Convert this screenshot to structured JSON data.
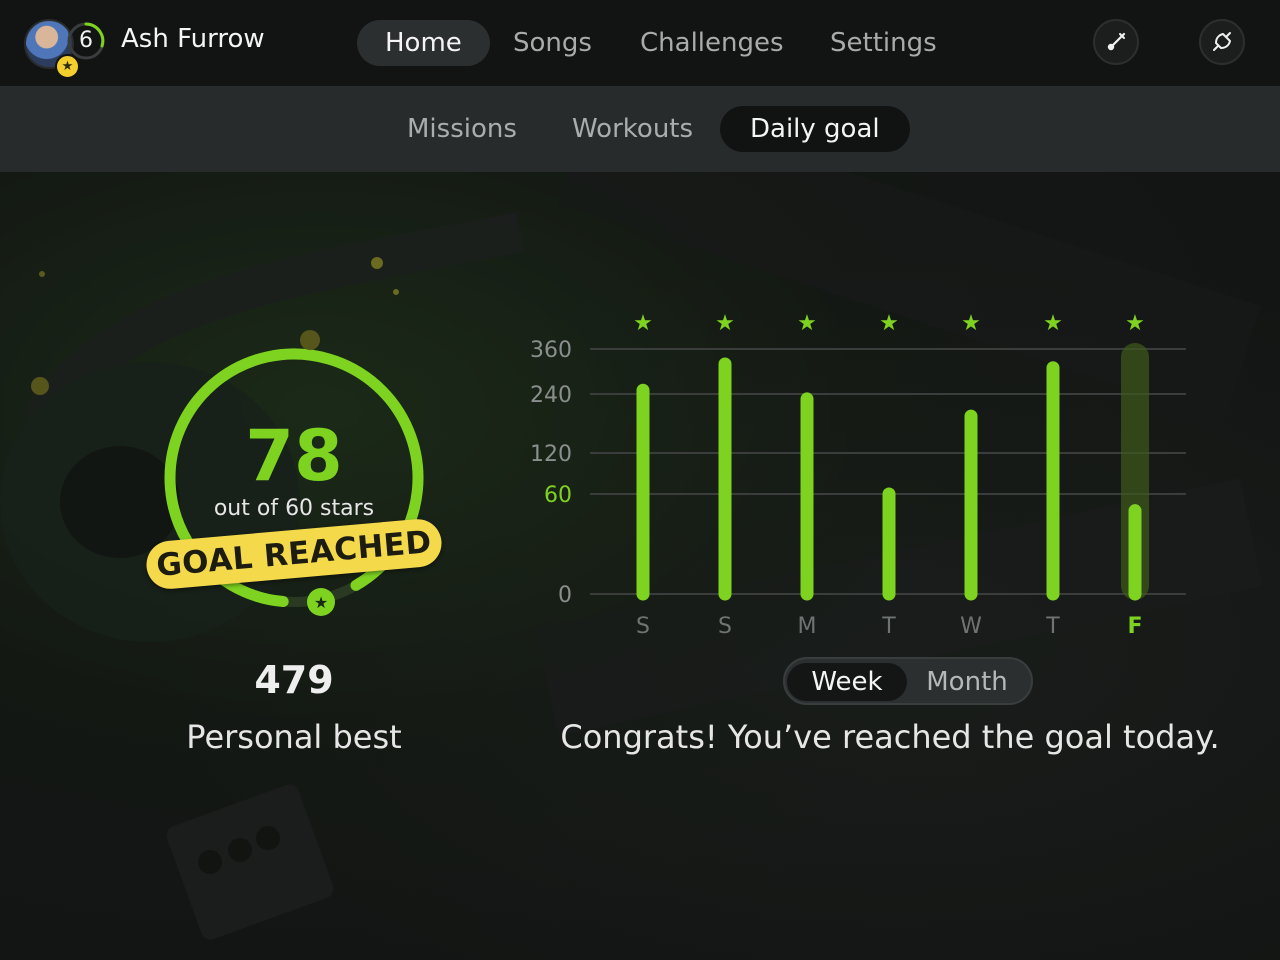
{
  "header": {
    "username": "Ash Furrow",
    "level": "6",
    "avatar_icon": "user-avatar",
    "badge_icon": "star-icon",
    "tabs": [
      {
        "label": "Home",
        "active": true
      },
      {
        "label": "Songs",
        "active": false
      },
      {
        "label": "Challenges",
        "active": false
      },
      {
        "label": "Settings",
        "active": false
      }
    ],
    "actions": [
      {
        "icon": "tuner-icon"
      },
      {
        "icon": "notifications-icon"
      }
    ]
  },
  "subnav": {
    "tabs": [
      {
        "label": "Missions",
        "active": false
      },
      {
        "label": "Workouts",
        "active": false
      },
      {
        "label": "Daily goal",
        "active": true
      }
    ]
  },
  "goal": {
    "stars": "78",
    "out_of": "out of 60 stars",
    "banner": "GOAL REACHED",
    "progress_fraction": 1.0,
    "personal_best_value": "479",
    "personal_best_label": "Personal best"
  },
  "chart_data": {
    "type": "bar",
    "categories": [
      "S",
      "S",
      "M",
      "T",
      "W",
      "T",
      "F"
    ],
    "values": [
      250,
      320,
      230,
      60,
      195,
      310,
      50
    ],
    "goal_reached": [
      true,
      true,
      true,
      true,
      true,
      true,
      true
    ],
    "highlight_index": 6,
    "yticks": [
      "360",
      "240",
      "120",
      "60",
      "0"
    ],
    "goal_tick": "60",
    "colors": {
      "bar": "#7ed321",
      "goal_tick": "#7ed321",
      "axis_text": "#8a8e8c",
      "grid": "#3a3d3c"
    }
  },
  "range_toggle": {
    "options": [
      {
        "label": "Week",
        "active": true
      },
      {
        "label": "Month",
        "active": false
      }
    ]
  },
  "message": "Congrats! You’ve reached the goal today."
}
